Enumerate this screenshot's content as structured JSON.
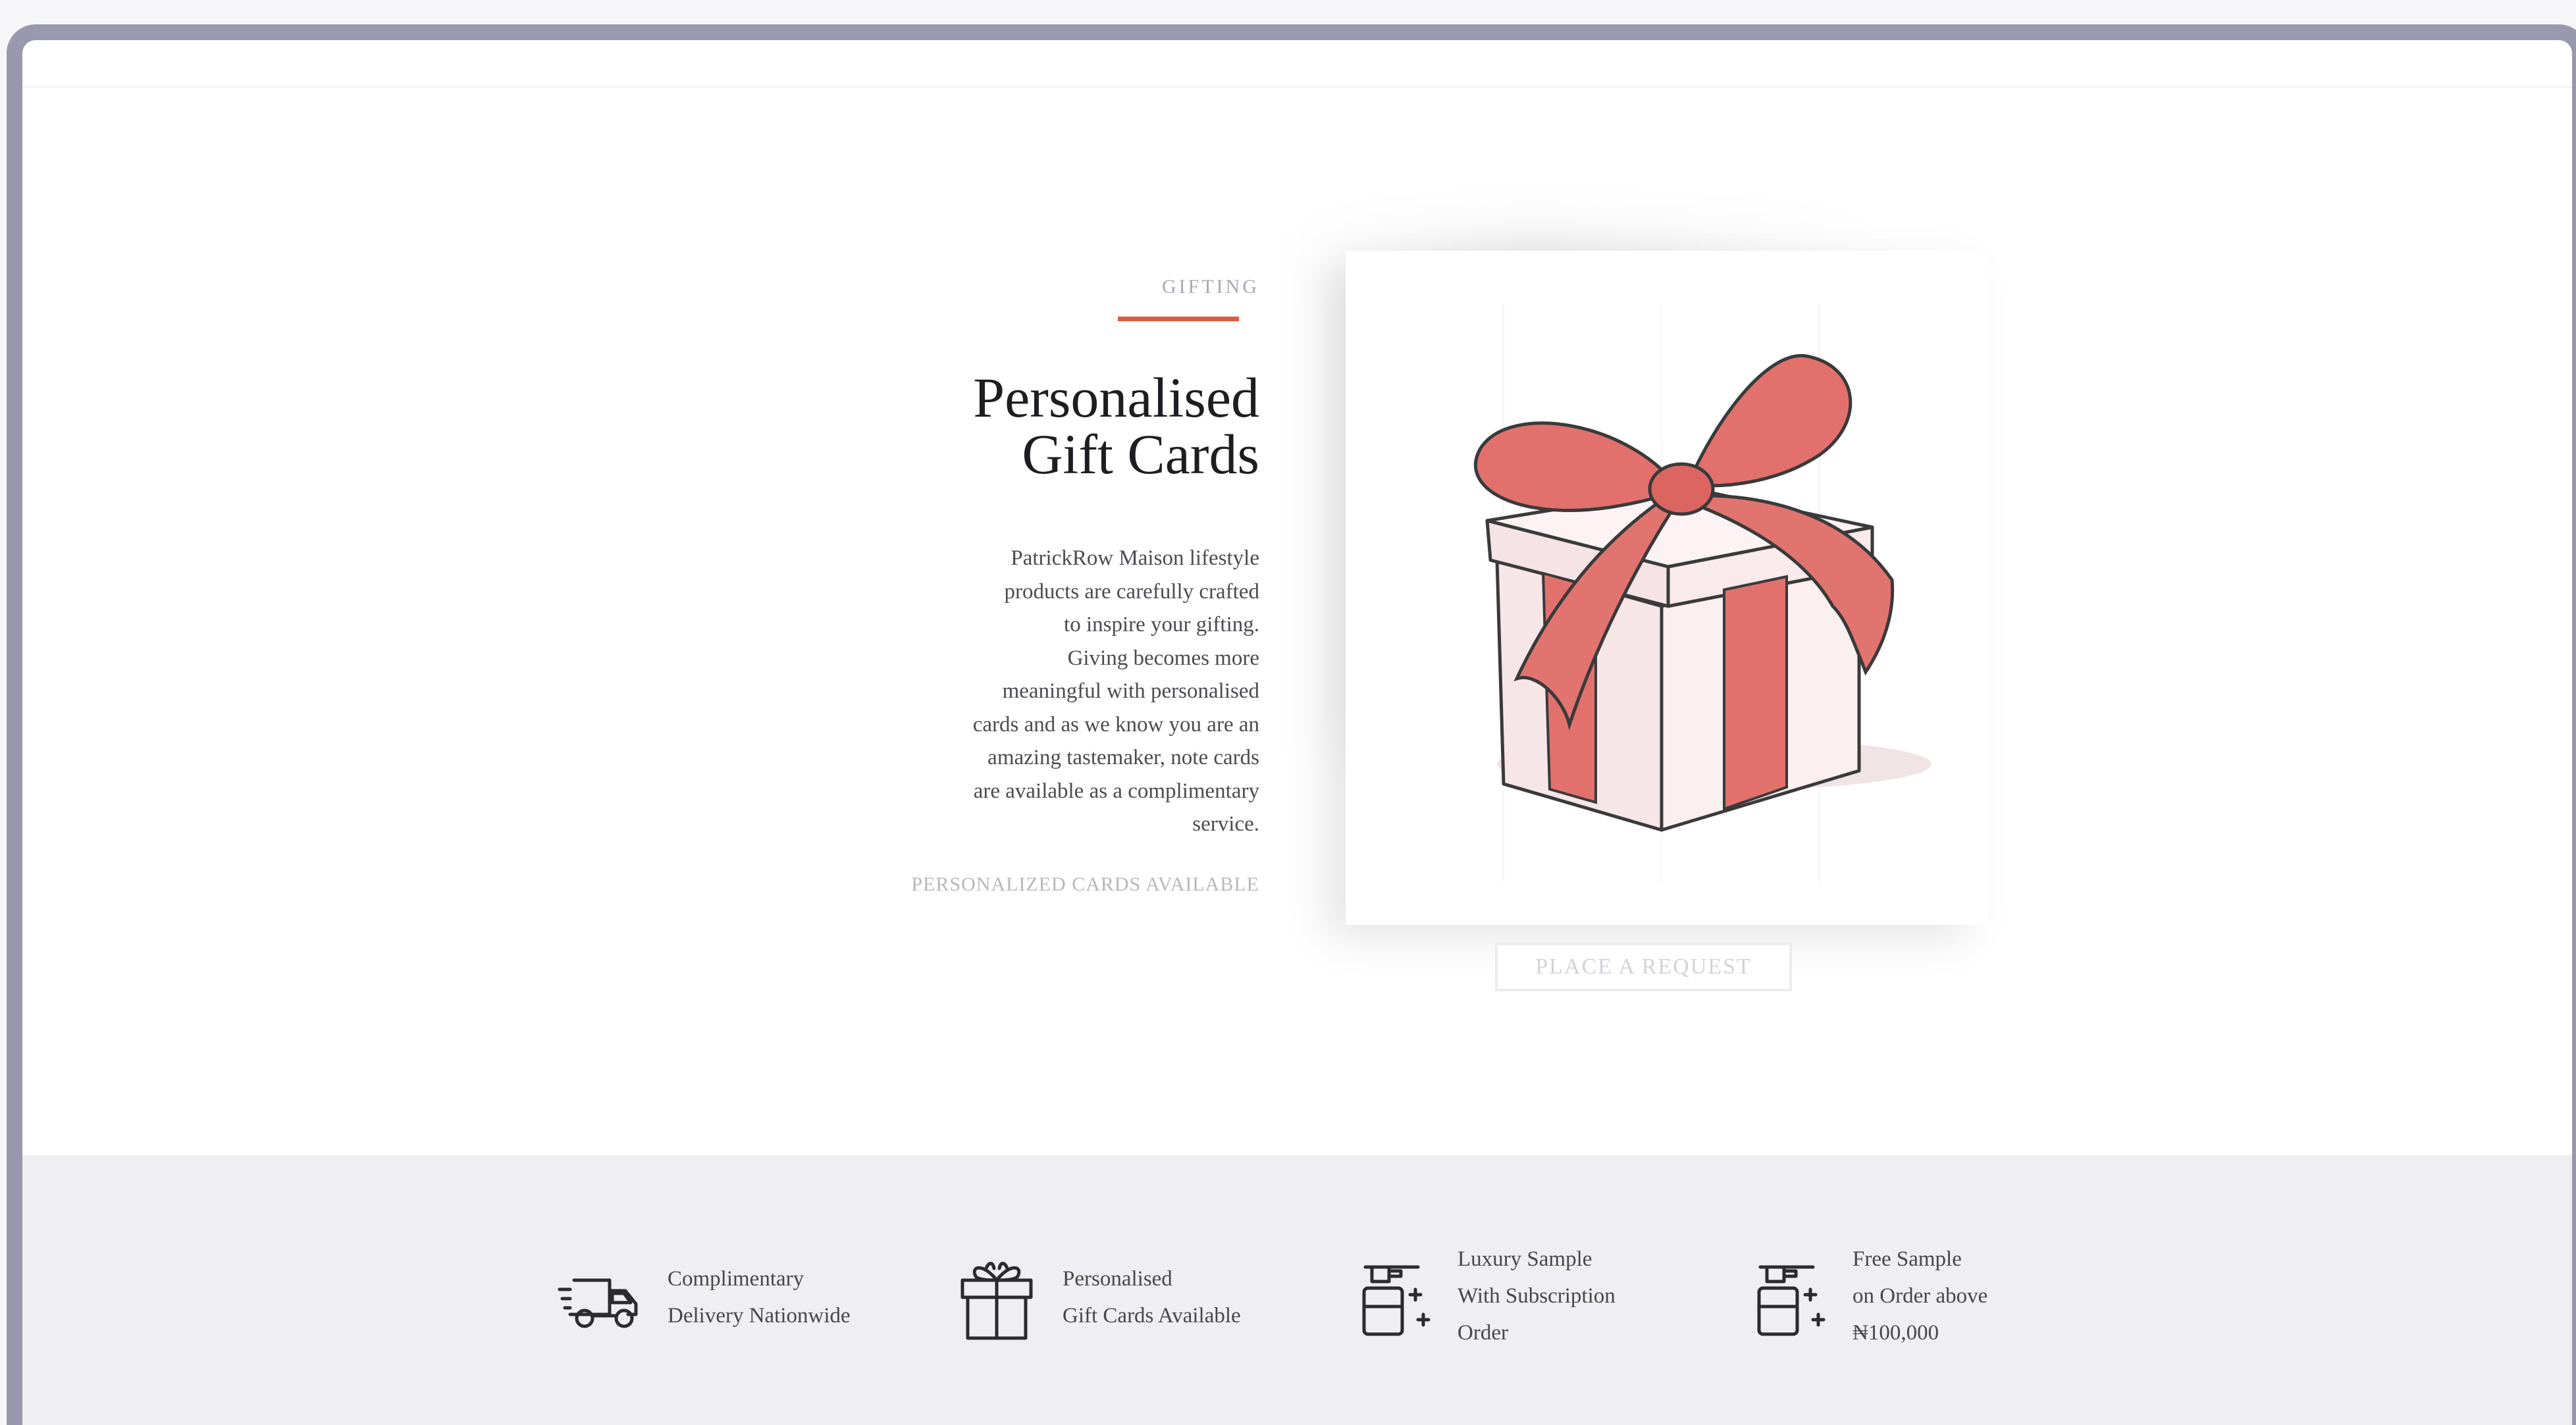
{
  "hero": {
    "eyebrow": "GIFTING",
    "headline_line1": "Personalised",
    "headline_line2": "Gift Cards",
    "body_lines": [
      "PatrickRow Maison lifestyle",
      "products are carefully crafted",
      "to inspire your gifting.",
      "Giving becomes more",
      "meaningful with personalised",
      "cards and as we know you are an",
      "amazing tastemaker, note cards",
      "are available as a complimentary",
      "service."
    ],
    "note": "PERSONALIZED CARDS AVAILABLE",
    "button_label": "PLACE A REQUEST"
  },
  "features": [
    {
      "icon": "delivery-truck-icon",
      "lines": [
        "Complimentary",
        "Delivery Nationwide"
      ]
    },
    {
      "icon": "gift-box-icon",
      "lines": [
        "Personalised",
        "Gift Cards Available"
      ]
    },
    {
      "icon": "perfume-sample-icon",
      "lines": [
        "Luxury Sample",
        "With Subscription",
        "Order"
      ]
    },
    {
      "icon": "perfume-sample-icon",
      "lines": [
        "Free Sample",
        "on Order above",
        "₦100,000"
      ]
    }
  ],
  "colors": {
    "accent": "#df5a3e",
    "ribbon": "#e2716d",
    "frame": "#9a98ae",
    "band": "#efeff1"
  }
}
